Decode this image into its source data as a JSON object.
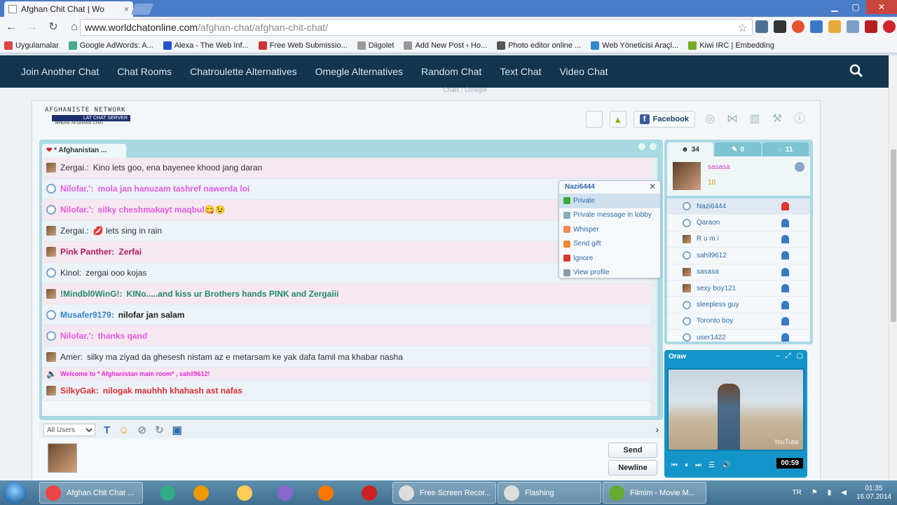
{
  "browser": {
    "tab_title": "Afghan Chit Chat | Wo",
    "tab_close": "×",
    "url_host": "www.worldchatonline.com",
    "url_path": "/afghan-chat/afghan-chit-chat/",
    "bookmarks": [
      {
        "label": "Uygulamalar",
        "color": "#d44"
      },
      {
        "label": "Google AdWords: A...",
        "color": "#4a8"
      },
      {
        "label": "Alexa - The Web Inf...",
        "color": "#25c"
      },
      {
        "label": "Free Web Submissio...",
        "color": "#c33"
      },
      {
        "label": "Diigolet",
        "color": "#999"
      },
      {
        "label": "Add New Post ‹ Ho...",
        "color": "#999"
      },
      {
        "label": "Photo editor online ...",
        "color": "#555"
      },
      {
        "label": "Web Yöneticisi Araçl...",
        "color": "#38c"
      },
      {
        "label": "Kiwi IRC | Embedding",
        "color": "#7a2"
      }
    ]
  },
  "site_nav": {
    "items": [
      "Join Another Chat",
      "Chat Rooms",
      "Chatroulette Alternatives",
      "Omegle Alternatives",
      "Random Chat",
      "Text Chat",
      "Video Chat"
    ],
    "breadcrumb_faint": "Chats / Omegle"
  },
  "chat": {
    "logo_line1": "AFGHANISTE NETWORK",
    "logo_line2": "LAT CHAT SERVER",
    "logo_line3": "WHERE AFGHANS CHAT",
    "facebook_label": "Facebook",
    "room_tab": "* Afghanistan ...",
    "messages": [
      {
        "nick": "Zergai.:",
        "text": "Kino lets goo, ena bayenee khood jang daran",
        "style": "plain",
        "color": "#333",
        "avatar": "photo",
        "bg": "pink"
      },
      {
        "nick": "Nilofar.':",
        "text": "mola jan hanuzam tashref nawerda loi",
        "style": "bold",
        "color": "#e35ae0",
        "avatar": "bubble",
        "bg": "blue"
      },
      {
        "nick": "Nilofar.':",
        "text": "silky cheshmakayt maqbul😋😉",
        "style": "bold",
        "color": "#e35ae0",
        "avatar": "bubble",
        "bg": "pink"
      },
      {
        "nick": "Zergai.:",
        "text": "💋  lets sing in rain",
        "style": "plain",
        "color": "#333",
        "avatar": "photo",
        "bg": "blue"
      },
      {
        "nick": "Pink Panther:",
        "text": "Zerfai",
        "style": "bold",
        "color": "#b1195a",
        "avatar": "photo",
        "bg": "pink"
      },
      {
        "nick": "Kinol:",
        "text": "zergai ooo kojas",
        "style": "plain",
        "color": "#333",
        "avatar": "bubble",
        "bg": "blue"
      },
      {
        "nick": "!Mindbl0WinG!:",
        "text": "KINo.....and kiss ur Brothers hands PINK and Zergaiii",
        "style": "bold",
        "color": "#1e8c6a",
        "avatar": "photo",
        "bg": "pink"
      },
      {
        "nick": "Musafer9179:",
        "text": "nilofar jan salam",
        "style": "bold",
        "color": "#222",
        "nick_color": "#2f86c8",
        "avatar": "bubble",
        "bg": "blue"
      },
      {
        "nick": "Nilofar.':",
        "text": "thanks qand",
        "style": "bold",
        "color": "#e35ae0",
        "avatar": "bubble",
        "bg": "pink"
      },
      {
        "nick": "Amer:",
        "text": "silky ma ziyad da ghesesh nistam az e metarsam ke yak dafa famil ma khabar nasha",
        "style": "plain",
        "color": "#333",
        "avatar": "photo",
        "bg": "blue"
      },
      {
        "nick": "",
        "text": "Welcome to * Afghanistan main room* , sahil9612!",
        "style": "system",
        "color": "#e02ad2",
        "avatar": "speaker",
        "bg": "pink"
      },
      {
        "nick": "SilkyGak:",
        "text": "nilogak mauhhh khahash ast nafas",
        "style": "bold",
        "color": "#d83030",
        "avatar": "photo",
        "bg": "blue"
      }
    ],
    "recipient_select": "All Users",
    "send_label": "Send",
    "newline_label": "Newline"
  },
  "users_panel": {
    "tab_users_count": "34",
    "tab_rooms_count": "0",
    "tab_msgs_count": "11",
    "me_name": "sasasa",
    "me_points": "10",
    "users": [
      {
        "name": "Nazi6444",
        "avatar": "bubble",
        "warn": true,
        "hl": true
      },
      {
        "name": "Qaraon",
        "avatar": "bubble"
      },
      {
        "name": "R u m i",
        "avatar": "photo"
      },
      {
        "name": "sahil9612",
        "avatar": "bubble"
      },
      {
        "name": "sasasa",
        "avatar": "photo"
      },
      {
        "name": "sexy boy121",
        "avatar": "photo"
      },
      {
        "name": "sleepless guy",
        "avatar": "bubble"
      },
      {
        "name": "Toronto boy",
        "avatar": "bubble"
      },
      {
        "name": "user1422",
        "avatar": "bubble"
      }
    ]
  },
  "context_menu": {
    "header": "Nazi6444",
    "items": [
      {
        "label": "Private",
        "color": "#3a3",
        "selected": true
      },
      {
        "label": "Private message in lobby",
        "color": "#8ab"
      },
      {
        "label": "Whisper",
        "color": "#e85"
      },
      {
        "label": "Send gift",
        "color": "#e83"
      },
      {
        "label": "Ignore",
        "color": "#d33"
      },
      {
        "label": "View profile",
        "color": "#89a"
      }
    ]
  },
  "video": {
    "title": "Oraw",
    "time": "00:59",
    "watermark": "YouTube"
  },
  "taskbar": {
    "items": [
      {
        "label": "Afghan Chit Chat ...",
        "color": "#e44",
        "active": true
      },
      {
        "label": "",
        "color": "#3a8"
      },
      {
        "label": "",
        "color": "#e90"
      },
      {
        "label": "",
        "color": "#fc5"
      },
      {
        "label": "",
        "color": "#86c"
      },
      {
        "label": "",
        "color": "#f70"
      },
      {
        "label": "",
        "color": "#c22"
      },
      {
        "label": "Free Screen Recor...",
        "color": "#ddd"
      },
      {
        "label": "Flashing",
        "color": "#ddd"
      },
      {
        "label": "Filmim - Movie M...",
        "color": "#6a3"
      }
    ],
    "lang": "TR",
    "time": "01:35",
    "date": "16.07.2014"
  }
}
